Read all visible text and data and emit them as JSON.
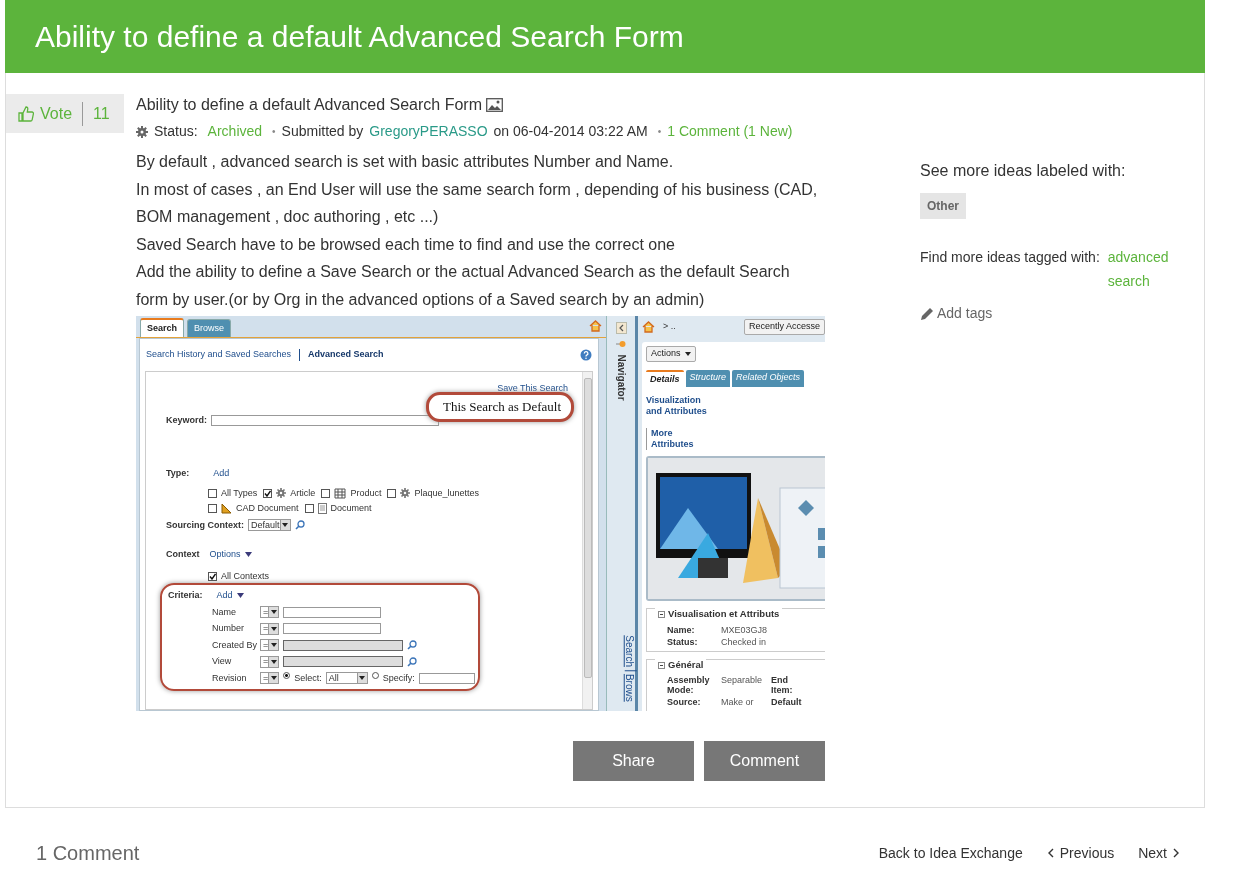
{
  "header": {
    "title": "Ability to define a default Advanced Search Form"
  },
  "vote": {
    "label": "Vote",
    "count": "11"
  },
  "idea": {
    "title": "Ability to define a default Advanced Search Form",
    "status_label": "Status:",
    "status": "Archived",
    "separators": [
      "•",
      "•"
    ],
    "submitted_by": "Submitted by",
    "author": "GregoryPERASSO",
    "date": "on 06-04-2014 03:22 AM",
    "comments_link": "1 Comment (1 New)",
    "body": [
      "By default , advanced search is set with basic attributes Number and Name.",
      "In most of cases , an End User will use the same search form , depending of his business (CAD, BOM management ,   doc authoring , etc ...)",
      "Saved Search have to be browsed each time to find and use the correct one",
      "Add the ability to define a Save Search or the actual Advanced Search as the default Search form by user.(or by Org in the advanced options of a Saved search by an admin)"
    ]
  },
  "screenshot": {
    "tabs": [
      {
        "label": "Search",
        "selected": true
      },
      {
        "label": "Browse",
        "selected": false
      }
    ],
    "subnav": [
      {
        "label": "Search History and Saved Searches",
        "selected": false
      },
      {
        "label": "Advanced Search",
        "selected": true
      }
    ],
    "save_link": "Save This Search",
    "callout": "This Search as Default",
    "keyword_label": "Keyword:",
    "type_label": "Type:",
    "type_add": "Add",
    "types": [
      {
        "label": "All Types",
        "checked": false
      },
      {
        "label": "Article",
        "checked": true
      },
      {
        "label": "Product",
        "checked": false
      },
      {
        "label": "Plaque_lunettes",
        "checked": false
      },
      {
        "label": "CAD Document",
        "checked": false
      },
      {
        "label": "Document",
        "checked": false
      }
    ],
    "sourcing_label": "Sourcing Context:",
    "sourcing_value": "Default",
    "context_label": "Context",
    "context_options": "Options",
    "all_contexts": {
      "label": "All Contexts",
      "checked": true
    },
    "criteria_label": "Criteria:",
    "criteria_add": "Add",
    "criteria": [
      {
        "label": "Name",
        "operator": "=",
        "kind": "text"
      },
      {
        "label": "Number",
        "operator": "=",
        "kind": "text"
      },
      {
        "label": "Created By",
        "operator": "=",
        "kind": "picker"
      },
      {
        "label": "View",
        "operator": "=",
        "kind": "picker"
      }
    ],
    "revision": {
      "label": "Revision",
      "operator": "=",
      "radios": [
        {
          "label": "Select:",
          "selected": true
        },
        {
          "label": "Specify:",
          "selected": false
        }
      ],
      "select_value": "All"
    },
    "navigator": {
      "title": "Navigator",
      "links": [
        "Search",
        "Brows"
      ]
    },
    "breadcrumb": ">  ..",
    "recent_button": "Recently Accesse",
    "actions_button": "Actions",
    "detail_tabs": [
      {
        "label": "Details",
        "selected": true
      },
      {
        "label": "Structure",
        "selected": false
      },
      {
        "label": "Related Objects",
        "selected": false
      }
    ],
    "detail_links": [
      "Visualization and Attributes",
      "More Attributes"
    ],
    "sections": [
      {
        "title": "Visualisation et Attributs",
        "rows": [
          {
            "label": "Name:",
            "value": "MXE03GJ8"
          },
          {
            "label": "Status:",
            "value": "Checked in"
          }
        ]
      },
      {
        "title": "Général",
        "rows": [
          {
            "label": "Assembly Mode:",
            "value": "Separable",
            "label_2": "End Item:"
          },
          {
            "label": "Source:",
            "value": "Make or",
            "label_2": "Default"
          }
        ]
      }
    ]
  },
  "actions": [
    "Share",
    "Comment"
  ],
  "sidebar": {
    "labeled_heading": "See more ideas labeled with:",
    "labels": [
      "Other"
    ],
    "tagged_heading": "Find more ideas tagged with:",
    "tags": [
      "advanced search"
    ],
    "add_tags": "Add tags"
  },
  "footer": {
    "comment_count": "1 Comment",
    "back_link": "Back to Idea Exchange",
    "previous": "Previous",
    "next": "Next"
  }
}
